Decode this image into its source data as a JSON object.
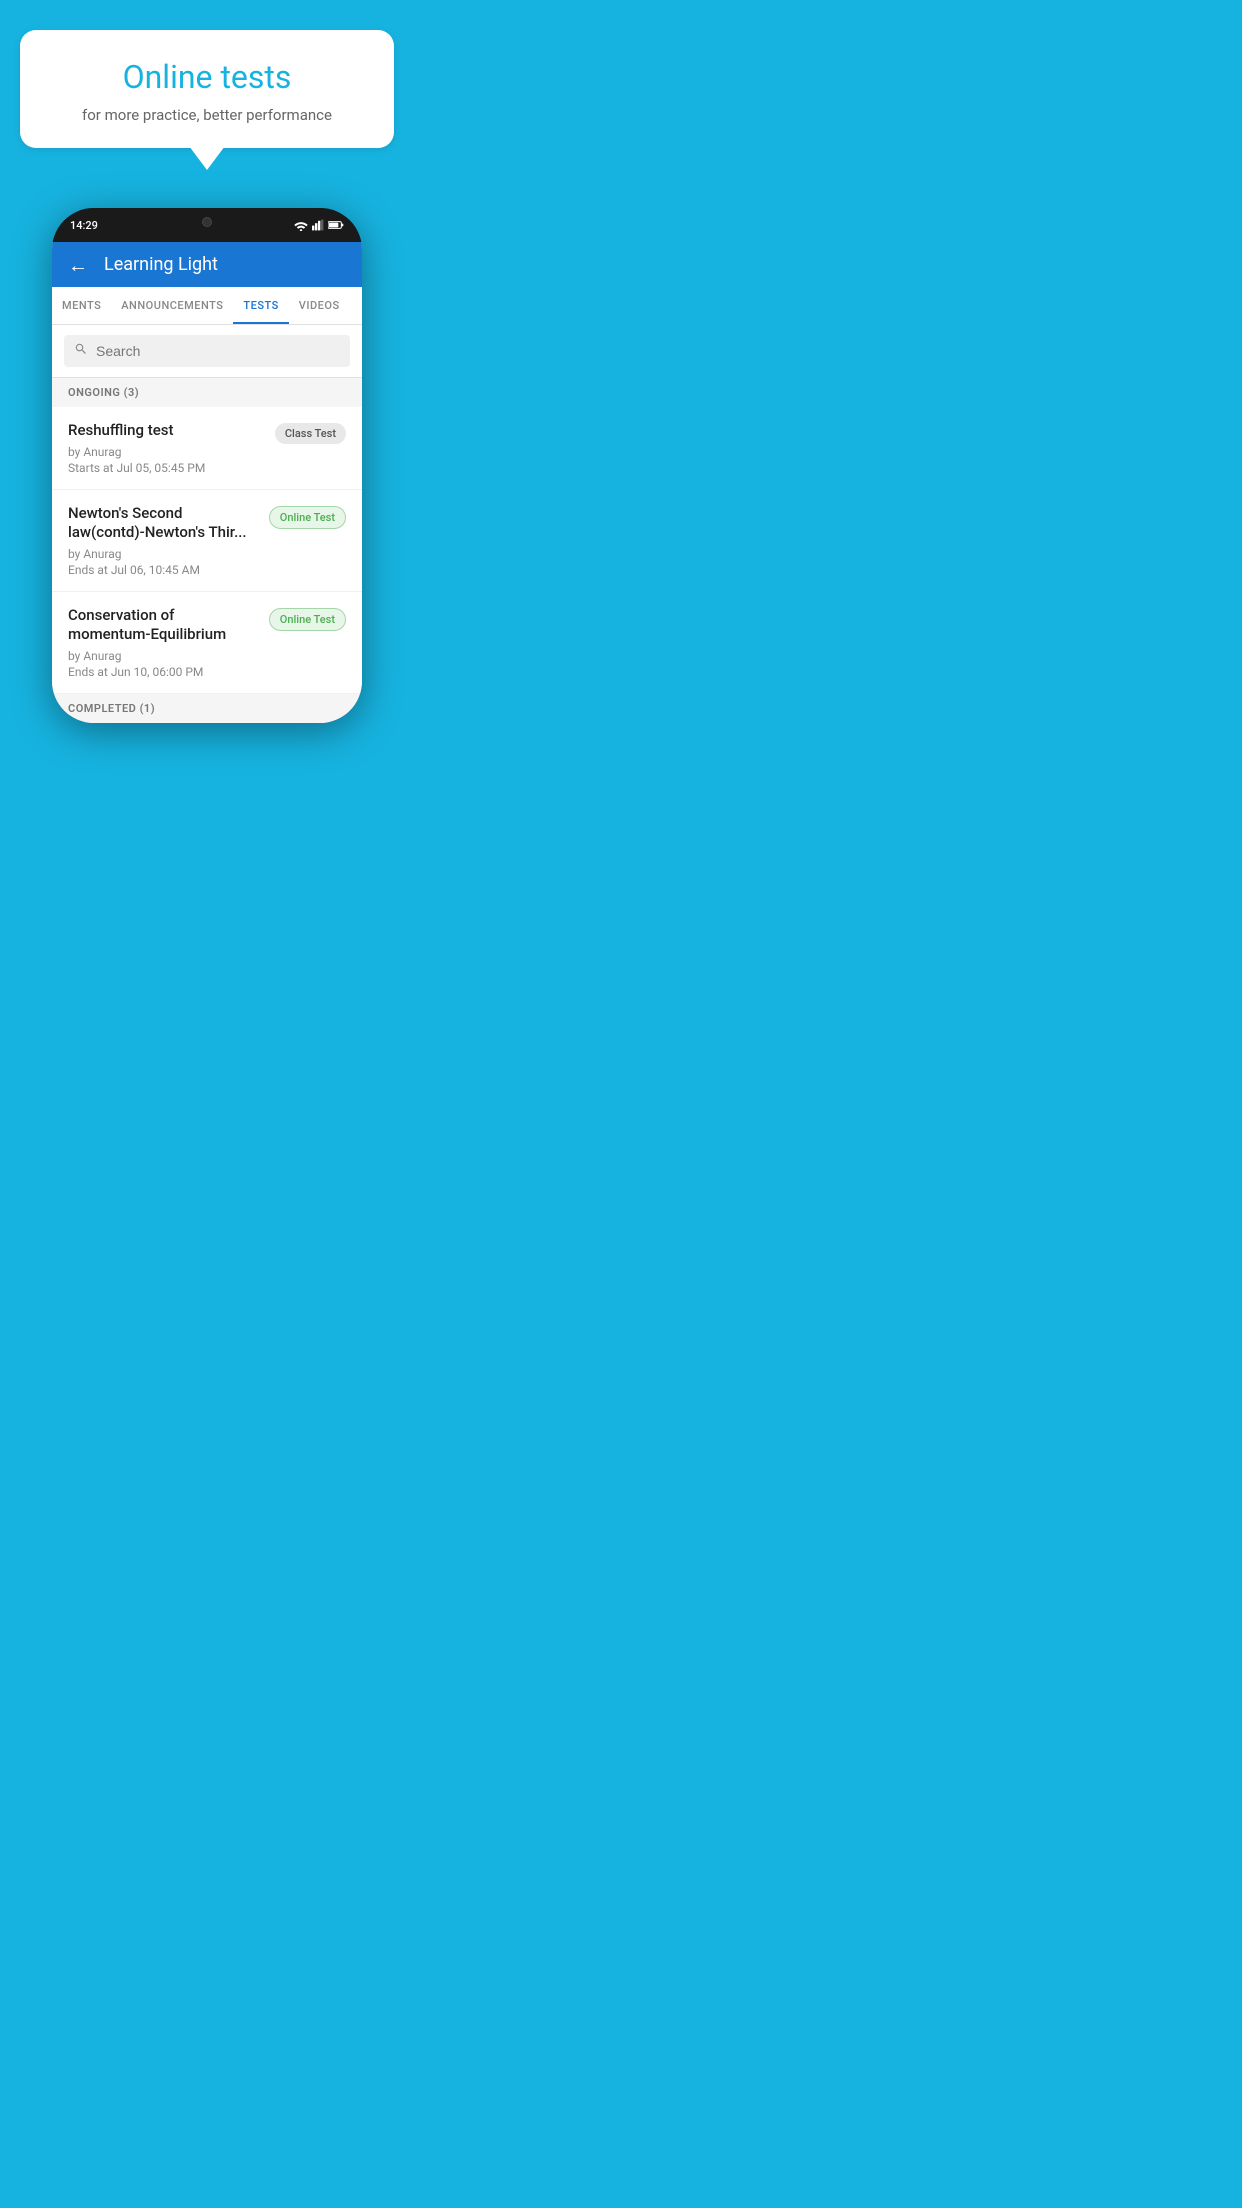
{
  "background_color": "#17b3e0",
  "bubble": {
    "title": "Online tests",
    "subtitle": "for more practice, better performance"
  },
  "phone": {
    "status_time": "14:29",
    "app_title": "Learning Light",
    "back_label": "←",
    "tabs": [
      {
        "id": "ments",
        "label": "MENTS",
        "active": false
      },
      {
        "id": "announcements",
        "label": "ANNOUNCEMENTS",
        "active": false
      },
      {
        "id": "tests",
        "label": "TESTS",
        "active": true
      },
      {
        "id": "videos",
        "label": "VIDEOS",
        "active": false
      }
    ],
    "search_placeholder": "Search",
    "ongoing_section": "ONGOING (3)",
    "tests": [
      {
        "name": "Reshuffling test",
        "by": "by Anurag",
        "time": "Starts at  Jul 05, 05:45 PM",
        "badge": "Class Test",
        "badge_type": "gray"
      },
      {
        "name": "Newton's Second law(contd)-Newton's Thir...",
        "by": "by Anurag",
        "time": "Ends at  Jul 06, 10:45 AM",
        "badge": "Online Test",
        "badge_type": "green"
      },
      {
        "name": "Conservation of momentum-Equilibrium",
        "by": "by Anurag",
        "time": "Ends at  Jun 10, 06:00 PM",
        "badge": "Online Test",
        "badge_type": "green"
      }
    ],
    "completed_section": "COMPLETED (1)"
  }
}
